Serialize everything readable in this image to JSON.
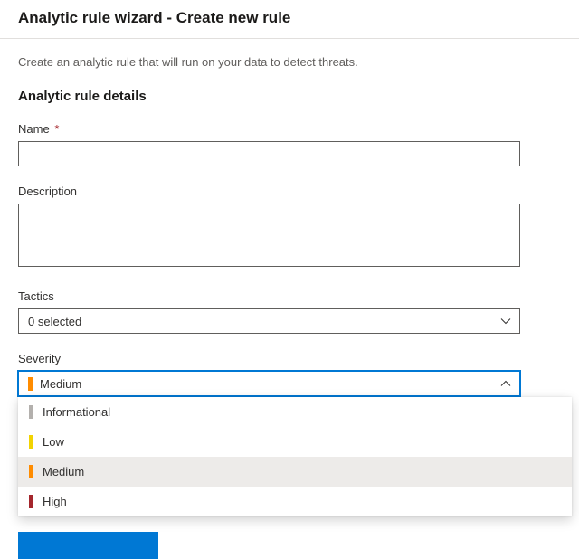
{
  "header": {
    "title": "Analytic rule wizard - Create new rule"
  },
  "intro": "Create an analytic rule that will run on your data to detect threats.",
  "section_title": "Analytic rule details",
  "fields": {
    "name": {
      "label": "Name",
      "required_mark": "*",
      "value": ""
    },
    "description": {
      "label": "Description",
      "value": ""
    },
    "tactics": {
      "label": "Tactics",
      "selected_text": "0 selected"
    },
    "severity": {
      "label": "Severity",
      "selected": {
        "label": "Medium",
        "class": "medium"
      },
      "options": [
        {
          "label": "Informational",
          "class": "info"
        },
        {
          "label": "Low",
          "class": "low"
        },
        {
          "label": "Medium",
          "class": "medium"
        },
        {
          "label": "High",
          "class": "high"
        }
      ]
    }
  }
}
